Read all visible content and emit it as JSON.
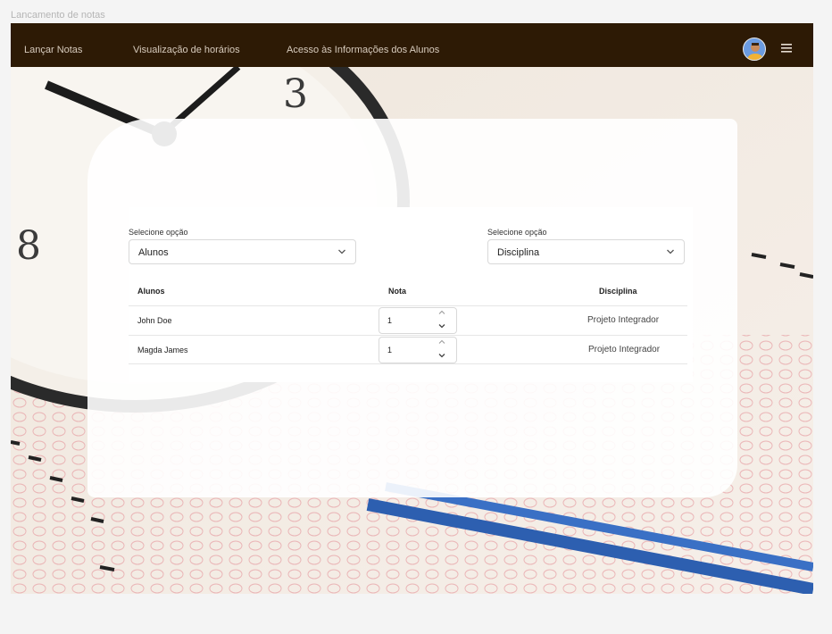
{
  "frame_title": "Lancamento de notas",
  "nav": {
    "items": [
      {
        "label": "Lançar Notas"
      },
      {
        "label": "Visualização de horários"
      },
      {
        "label": "Acesso às Informações dos Alunos"
      }
    ]
  },
  "filters": {
    "left": {
      "label": "Selecione opção",
      "value": "Alunos"
    },
    "right": {
      "label": "Selecione opção",
      "value": "Disciplina"
    }
  },
  "table": {
    "headers": [
      "Alunos",
      "Nota",
      "Disciplina"
    ],
    "rows": [
      {
        "aluno": "John Doe",
        "nota": "1",
        "disciplina": "Projeto Integrador"
      },
      {
        "aluno": "Magda James",
        "nota": "1",
        "disciplina": "Projeto Integrador"
      }
    ]
  },
  "colors": {
    "navbar": "#2d1a05",
    "card": "#ffffff"
  }
}
